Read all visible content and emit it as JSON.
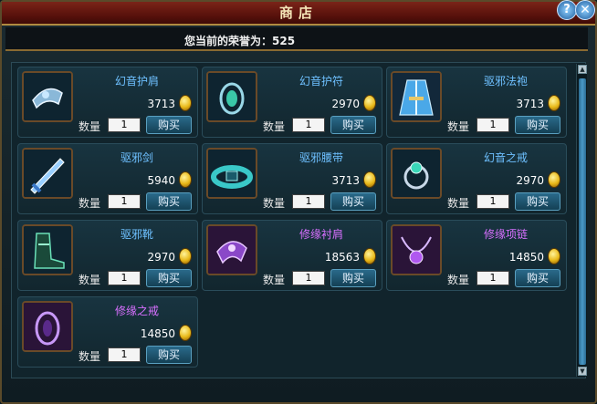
{
  "window": {
    "title": "商店",
    "help_glyph": "?",
    "close_glyph": "✕"
  },
  "honor": {
    "text": "您当前的荣誉为：525"
  },
  "labels": {
    "quantity": "数量",
    "buy": "购买"
  },
  "items": [
    {
      "name": "幻音护肩",
      "price": "3713",
      "qty": "1",
      "name_color": "blue",
      "icon": "shoulder-guard-icon"
    },
    {
      "name": "幻音护符",
      "price": "2970",
      "qty": "1",
      "name_color": "blue",
      "icon": "amulet-icon"
    },
    {
      "name": "驱邪法袍",
      "price": "3713",
      "qty": "1",
      "name_color": "blue",
      "icon": "robe-icon"
    },
    {
      "name": "驱邪剑",
      "price": "5940",
      "qty": "1",
      "name_color": "blue",
      "icon": "sword-icon"
    },
    {
      "name": "驱邪腰带",
      "price": "3713",
      "qty": "1",
      "name_color": "blue",
      "icon": "belt-icon"
    },
    {
      "name": "幻音之戒",
      "price": "2970",
      "qty": "1",
      "name_color": "blue",
      "icon": "ring-icon"
    },
    {
      "name": "驱邪靴",
      "price": "2970",
      "qty": "1",
      "name_color": "blue",
      "icon": "boots-icon"
    },
    {
      "name": "修缘衬肩",
      "price": "18563",
      "qty": "1",
      "name_color": "purple",
      "icon": "shoulder-pad-icon"
    },
    {
      "name": "修缘项链",
      "price": "14850",
      "qty": "1",
      "name_color": "purple",
      "icon": "necklace-icon"
    },
    {
      "name": "修缘之戒",
      "price": "14850",
      "qty": "1",
      "name_color": "purple",
      "icon": "purple-ring-icon"
    }
  ],
  "colors": {
    "blue_name": "#6ec0ff",
    "purple_name": "#d870ff",
    "title_bar": "#7a2418",
    "panel": "#11242c"
  }
}
